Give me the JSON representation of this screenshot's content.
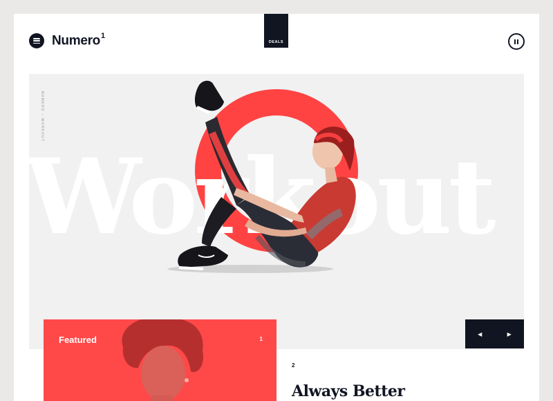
{
  "header": {
    "brand": "Numero",
    "brand_superscript": "1",
    "deals_label": "DEALS"
  },
  "hero": {
    "vertical_label": "NUMERO – WORKOUT",
    "big_word": "Workout",
    "accent_color": "#ff4343"
  },
  "featured": {
    "title": "Featured",
    "index": "1"
  },
  "second_card": {
    "index": "2",
    "title": "Always Better"
  },
  "icons": {
    "menu": "hamburger-menu-icon",
    "pause": "pause-icon",
    "prev": "arrow-left-icon",
    "next": "arrow-right-icon"
  },
  "colors": {
    "dark": "#111522",
    "red": "#ff4949",
    "hero_bg": "#f1f1f1"
  }
}
